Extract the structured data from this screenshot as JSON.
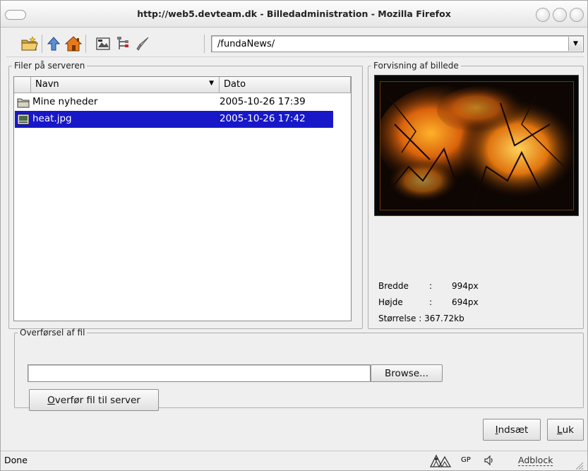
{
  "window": {
    "title": "http://web5.devteam.dk - Billedadministration - Mozilla Firefox"
  },
  "toolbar": {
    "icons": [
      "new-folder-icon",
      "up-arrow-icon",
      "home-icon",
      "image-view-icon",
      "tree-icon",
      "brush-icon"
    ],
    "path_value": "/fundaNews/"
  },
  "files_panel": {
    "legend": "Filer på serveren",
    "columns": {
      "name": "Navn",
      "date": "Dato"
    },
    "rows": [
      {
        "name": "Mine nyheder",
        "date": "2005-10-26 17:39",
        "icon": "folder-icon",
        "selected": false
      },
      {
        "name": "heat.jpg",
        "date": "2005-10-26 17:42",
        "icon": "image-file-icon",
        "selected": true
      }
    ]
  },
  "preview_panel": {
    "legend": "Forvisning af billede",
    "info": {
      "width_label": "Bredde",
      "width_value": "994px",
      "height_label": "Højde",
      "height_value": "694px",
      "size_label": "Størrelse",
      "size_value": "367.72kb",
      "colon": ":"
    }
  },
  "upload_panel": {
    "legend": "Overførsel af fil",
    "file_value": "",
    "browse_label": "Browse...",
    "upload_label_accel": "O",
    "upload_label_rest": "verfør fil til server"
  },
  "dialog": {
    "insert_accel": "I",
    "insert_rest": "ndsæt",
    "close_accel": "L",
    "close_rest": "uk"
  },
  "statusbar": {
    "status": "Done",
    "gp": "GP",
    "adblock": "Adblock"
  },
  "colors": {
    "selection": "#1818c8",
    "window_bg": "#efefef"
  }
}
